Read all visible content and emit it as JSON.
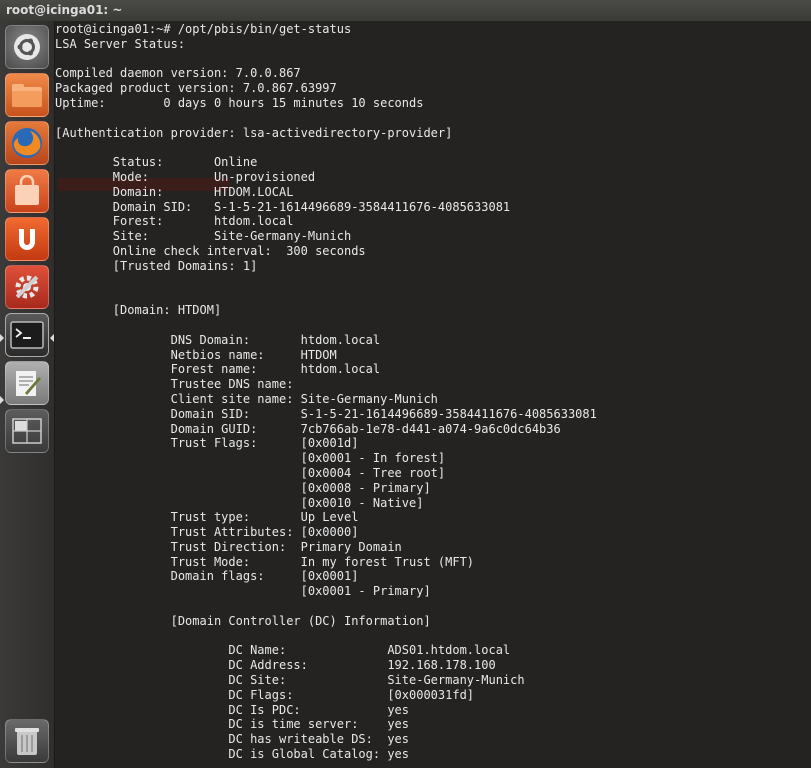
{
  "window": {
    "title": "root@icinga01: ~"
  },
  "launcher": {
    "items": [
      {
        "name": "dash-home",
        "color": "#6b6b6b"
      },
      {
        "name": "files",
        "color": "#e0692c"
      },
      {
        "name": "firefox",
        "color": "#d8632a"
      },
      {
        "name": "software-center",
        "color": "#e85a2a"
      },
      {
        "name": "ubuntu-one",
        "color": "#e35b22"
      },
      {
        "name": "system-settings",
        "color": "#c83a2a"
      },
      {
        "name": "terminal",
        "color": "#3c3c3c"
      },
      {
        "name": "text-editor",
        "color": "#9a9a9a"
      },
      {
        "name": "workspace-switcher",
        "color": "#505050"
      },
      {
        "name": "trash",
        "color": "#6a6a6a"
      }
    ]
  },
  "terminal": {
    "lines": [
      "root@icinga01:~# /opt/pbis/bin/get-status",
      "LSA Server Status:",
      "",
      "Compiled daemon version: 7.0.0.867",
      "Packaged product version: 7.0.867.63997",
      "Uptime:        0 days 0 hours 15 minutes 10 seconds",
      "",
      "[Authentication provider: lsa-activedirectory-provider]",
      "",
      "        Status:       Online",
      "        Mode:         Un-provisioned",
      "        Domain:       HTDOM.LOCAL",
      "        Domain SID:   S-1-5-21-1614496689-3584411676-4085633081",
      "        Forest:       htdom.local",
      "        Site:         Site-Germany-Munich",
      "        Online check interval:  300 seconds",
      "        [Trusted Domains: 1]",
      "",
      "",
      "        [Domain: HTDOM]",
      "",
      "                DNS Domain:       htdom.local",
      "                Netbios name:     HTDOM",
      "                Forest name:      htdom.local",
      "                Trustee DNS name:",
      "                Client site name: Site-Germany-Munich",
      "                Domain SID:       S-1-5-21-1614496689-3584411676-4085633081",
      "                Domain GUID:      7cb766ab-1e78-d441-a074-9a6c0dc64b36",
      "                Trust Flags:      [0x001d]",
      "                                  [0x0001 - In forest]",
      "                                  [0x0004 - Tree root]",
      "                                  [0x0008 - Primary]",
      "                                  [0x0010 - Native]",
      "                Trust type:       Up Level",
      "                Trust Attributes: [0x0000]",
      "                Trust Direction:  Primary Domain",
      "                Trust Mode:       In my forest Trust (MFT)",
      "                Domain flags:     [0x0001]",
      "                                  [0x0001 - Primary]",
      "",
      "                [Domain Controller (DC) Information]",
      "",
      "                        DC Name:              ADS01.htdom.local",
      "                        DC Address:           192.168.178.100",
      "                        DC Site:              Site-Germany-Munich",
      "                        DC Flags:             [0x000031fd]",
      "                        DC Is PDC:            yes",
      "                        DC is time server:    yes",
      "                        DC has writeable DS:  yes",
      "                        DC is Global Catalog: yes"
    ]
  }
}
